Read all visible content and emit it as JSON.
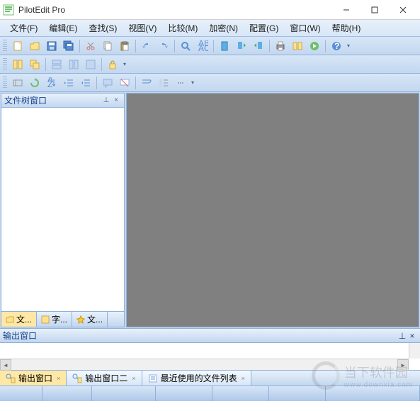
{
  "app": {
    "title": "PilotEdit Pro"
  },
  "menu": {
    "file": "文件(F)",
    "edit": "编辑(E)",
    "search": "查找(S)",
    "view": "视图(V)",
    "compare": "比较(M)",
    "encrypt": "加密(N)",
    "config": "配置(G)",
    "window": "窗口(W)",
    "help": "帮助(H)"
  },
  "panels": {
    "file_tree": {
      "title": "文件树窗口"
    },
    "output": {
      "title": "输出窗口"
    }
  },
  "sidebar_tabs": {
    "t1": "文...",
    "t2": "字...",
    "t3": "文..."
  },
  "bottom_tabs": {
    "out1": "输出窗口",
    "out2": "输出窗口二",
    "recent": "最近使用的文件列表"
  },
  "watermark": {
    "text1": "当下软件园",
    "text2": "www.downxia.com"
  },
  "colors": {
    "accent": "#c3d7ef",
    "highlight": "#ffe8a6",
    "editor_bg": "#808080"
  }
}
